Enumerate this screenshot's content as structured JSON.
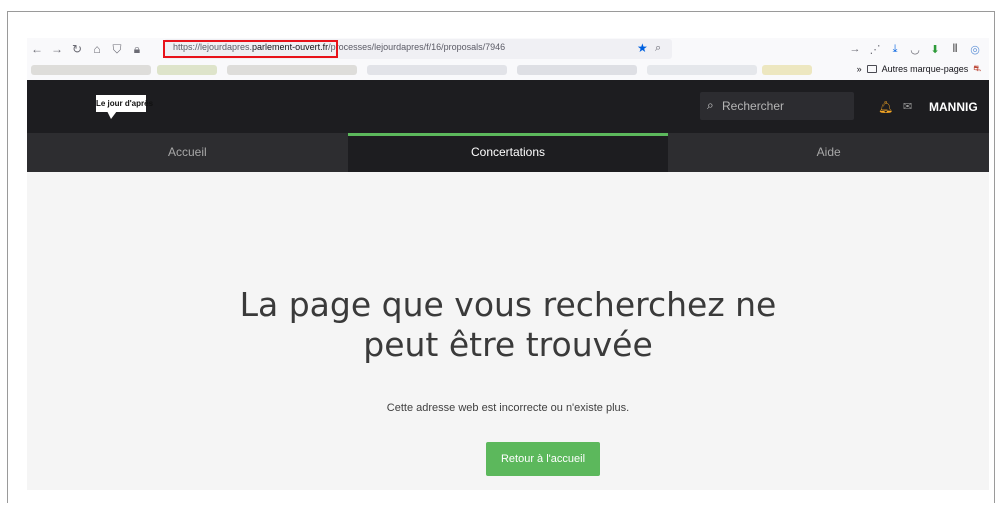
{
  "browser": {
    "url_prefix": "https://lejourdapres.",
    "url_domain": "parlement-ouvert.fr",
    "url_path": "/processes/lejourdapres/f/16/proposals/7946",
    "bookmarks_folder_label": "Autres marque-pages",
    "overflow_label": "»"
  },
  "site": {
    "logo_text": "Le jour d'après",
    "search_placeholder": "Rechercher",
    "user_name": "MANNIG",
    "nav": [
      {
        "label": "Accueil"
      },
      {
        "label": "Concertations"
      },
      {
        "label": "Aide"
      }
    ],
    "active_tab": "Concertations"
  },
  "error_page": {
    "title_line1": "La page que vous recherchez ne",
    "title_line2": "peut être trouvée",
    "subtitle": "Cette adresse web est incorrecte ou n'existe plus.",
    "button_label": "Retour à l'accueil"
  },
  "colors": {
    "accent_green": "#5cb85c",
    "header_dark": "#1d1d20",
    "highlight_red": "#e8121a",
    "bell_orange": "#f5a623"
  },
  "icons": [
    "back-icon",
    "forward-icon",
    "reload-icon",
    "home-icon",
    "shield-icon",
    "lock-icon",
    "star-icon",
    "search-icon",
    "bell-icon",
    "mail-icon"
  ]
}
